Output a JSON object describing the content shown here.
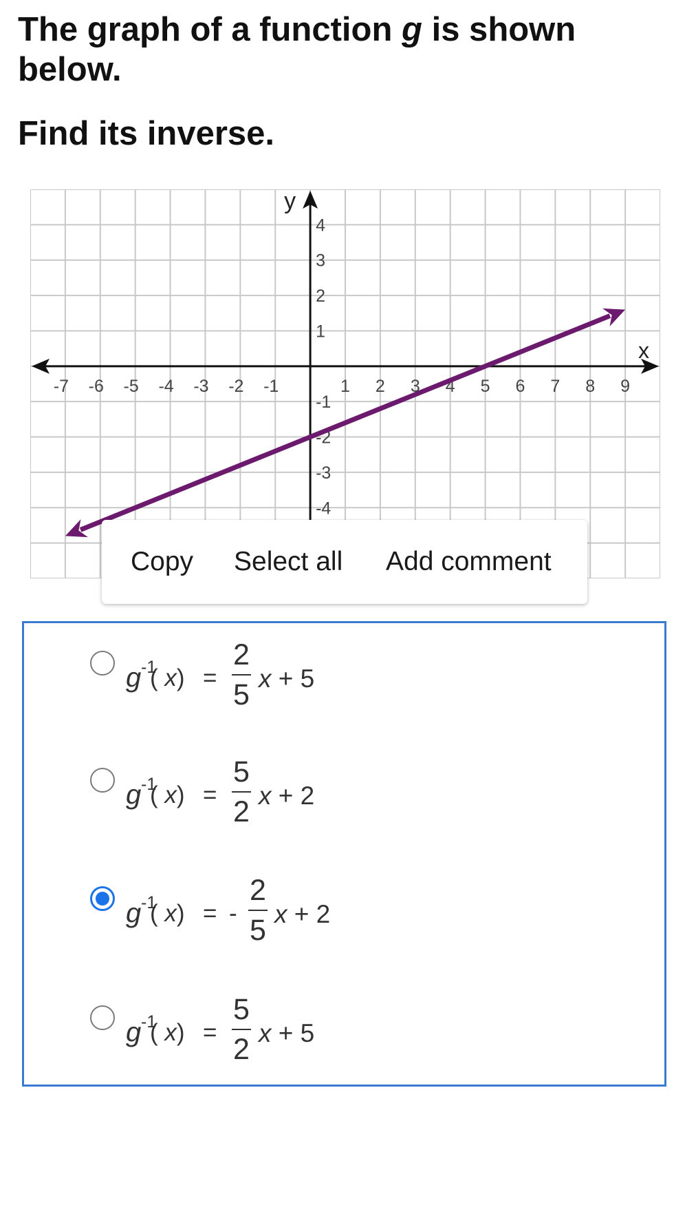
{
  "question": {
    "line1_before": "The graph of a function ",
    "line1_var": "g",
    "line1_after": " is shown below.",
    "line2": "Find its inverse."
  },
  "graph": {
    "x_axis_label": "x",
    "y_axis_label": "y",
    "x_tick_labels": [
      "-7",
      "-6",
      "-5",
      "-4",
      "-3",
      "-2",
      "-1",
      "1",
      "2",
      "3",
      "4",
      "5",
      "6",
      "7",
      "8",
      "9"
    ],
    "y_tick_labels": [
      "4",
      "3",
      "2",
      "1",
      "-1",
      "-2",
      "-3",
      "-4"
    ],
    "x_range": [
      -8,
      10
    ],
    "y_range": [
      -6,
      5
    ],
    "grid": true,
    "line_color": "#6b1a6e",
    "line": {
      "slope": 0.4,
      "intercept": -2,
      "x_start": -7,
      "x_end": 9
    }
  },
  "context_menu": {
    "copy": "Copy",
    "select_all": "Select all",
    "add_comment": "Add comment"
  },
  "options": [
    {
      "fn": "g",
      "sup": "-1",
      "arg_open": "( ",
      "arg_var": "x",
      "arg_close": ")",
      "eq": "=",
      "sign": "",
      "num": "2",
      "den": "5",
      "tail_var": "x",
      "tail": " + 5",
      "selected": false
    },
    {
      "fn": "g",
      "sup": "-1",
      "arg_open": "( ",
      "arg_var": "x",
      "arg_close": ")",
      "eq": "=",
      "sign": "",
      "num": "5",
      "den": "2",
      "tail_var": "x",
      "tail": " + 2",
      "selected": false
    },
    {
      "fn": "g",
      "sup": "-1",
      "arg_open": "( ",
      "arg_var": "x",
      "arg_close": ")",
      "eq": "=",
      "sign": "-",
      "num": "2",
      "den": "5",
      "tail_var": "x",
      "tail": " + 2",
      "selected": true
    },
    {
      "fn": "g",
      "sup": "-1",
      "arg_open": "( ",
      "arg_var": "x",
      "arg_close": ")",
      "eq": "=",
      "sign": "",
      "num": "5",
      "den": "2",
      "tail_var": "x",
      "tail": " + 5",
      "selected": false
    }
  ],
  "colors": {
    "accent": "#1a73e8",
    "answer_border": "#3a7ad0",
    "graph_line": "#6b1a6e",
    "grid": "#c8c8c8"
  }
}
